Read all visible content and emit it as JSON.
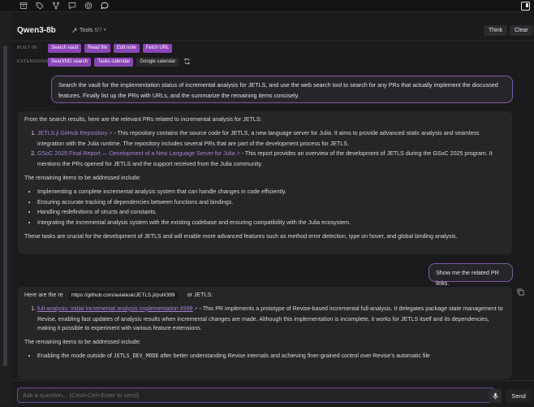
{
  "header": {
    "model_name": "Qwen3-8b",
    "tools_label": "Tools",
    "tools_count": "6/7",
    "think_label": "Think",
    "clear_label": "Clear"
  },
  "toolbar": {
    "builtin_label": "BUILT-IN",
    "builtin_tools": [
      "Search vault",
      "Read file",
      "Edit note",
      "Fetch URL"
    ],
    "extensions_label": "EXTENSIONS",
    "extension_tools": [
      "SearXNG search",
      "Tasks calendar",
      "Google calendar"
    ]
  },
  "messages": {
    "user1": "Search the vault for the implementation status of incremental analysis for JETLS, and use the web search tool to search for any PRs that actually implement the discussed features. Finally list up the PRs with URLs, and the summarize the remaining items concisely.",
    "assistant1": {
      "intro": "From the search results, here are the relevant PRs related to incremental analysis for JETLS:",
      "prs": [
        {
          "title": "JETLS.jl GitHub Repository",
          "desc": " - This repository contains the source code for JETLS, a new language server for Julia. It aims to provide advanced static analysis and seamless integration with the Julia runtime. The repository includes several PRs that are part of the development process for JETLS."
        },
        {
          "title": "GSoC 2025 Final Report — Development of a New Language Server for Julia",
          "desc": " - This report provides an overview of the development of JETLS during the GSoC 2025 program. It mentions the PRs opened for JETLS and the support received from the Julia community."
        }
      ],
      "remaining_heading": "The remaining items to be addressed include:",
      "remaining": [
        "Implementing a complete incremental analysis system that can handle changes in code efficiently.",
        "Ensuring accurate tracking of dependencies between functions and bindings.",
        "Handling redefinitions of structs and constants.",
        "Integrating the incremental analysis system with the existing codebase and ensuring compatibility with the Julia ecosystem."
      ],
      "closing": "These tasks are crucial for the development of JETLS and will enable more advanced features such as method error detection, type on hover, and global binding analysis."
    },
    "user2": "Show me the related PR links.",
    "assistant2": {
      "intro_start": "Here are the re",
      "intro_end": "or JETLS:",
      "tooltip_url": "https://github.com/aviatesk/JETLS.jl/pull/399",
      "pr": {
        "title": "full-analysis: Initial incremental analysis implementation #399",
        "desc": " - This PR implements a prototype of Revise-based incremental full-analysis. It delegates package state management to Revise, enabling fast updates of analysis results when incremental changes are made. Although this implementation is incomplete, it works for JETLS itself and its dependencies, making it possible to experiment with various feature extensions."
      },
      "remaining_heading": "The remaining items to be addressed include:",
      "remaining_start": "Enabling the mode outside of ",
      "remaining_code": "JETLS_DEV_MODE",
      "remaining_end": " after better understanding Revise internals and achieving finer-grained control over Revise's automatic file"
    }
  },
  "composer": {
    "placeholder": "Ask a question... (Cmd+Ctrl+Enter to send)",
    "send_label": "Send"
  },
  "colors": {
    "accent": "#8b45b5",
    "link": "#a782d8",
    "background": "#1b1b1d",
    "bubble": "#262628"
  }
}
